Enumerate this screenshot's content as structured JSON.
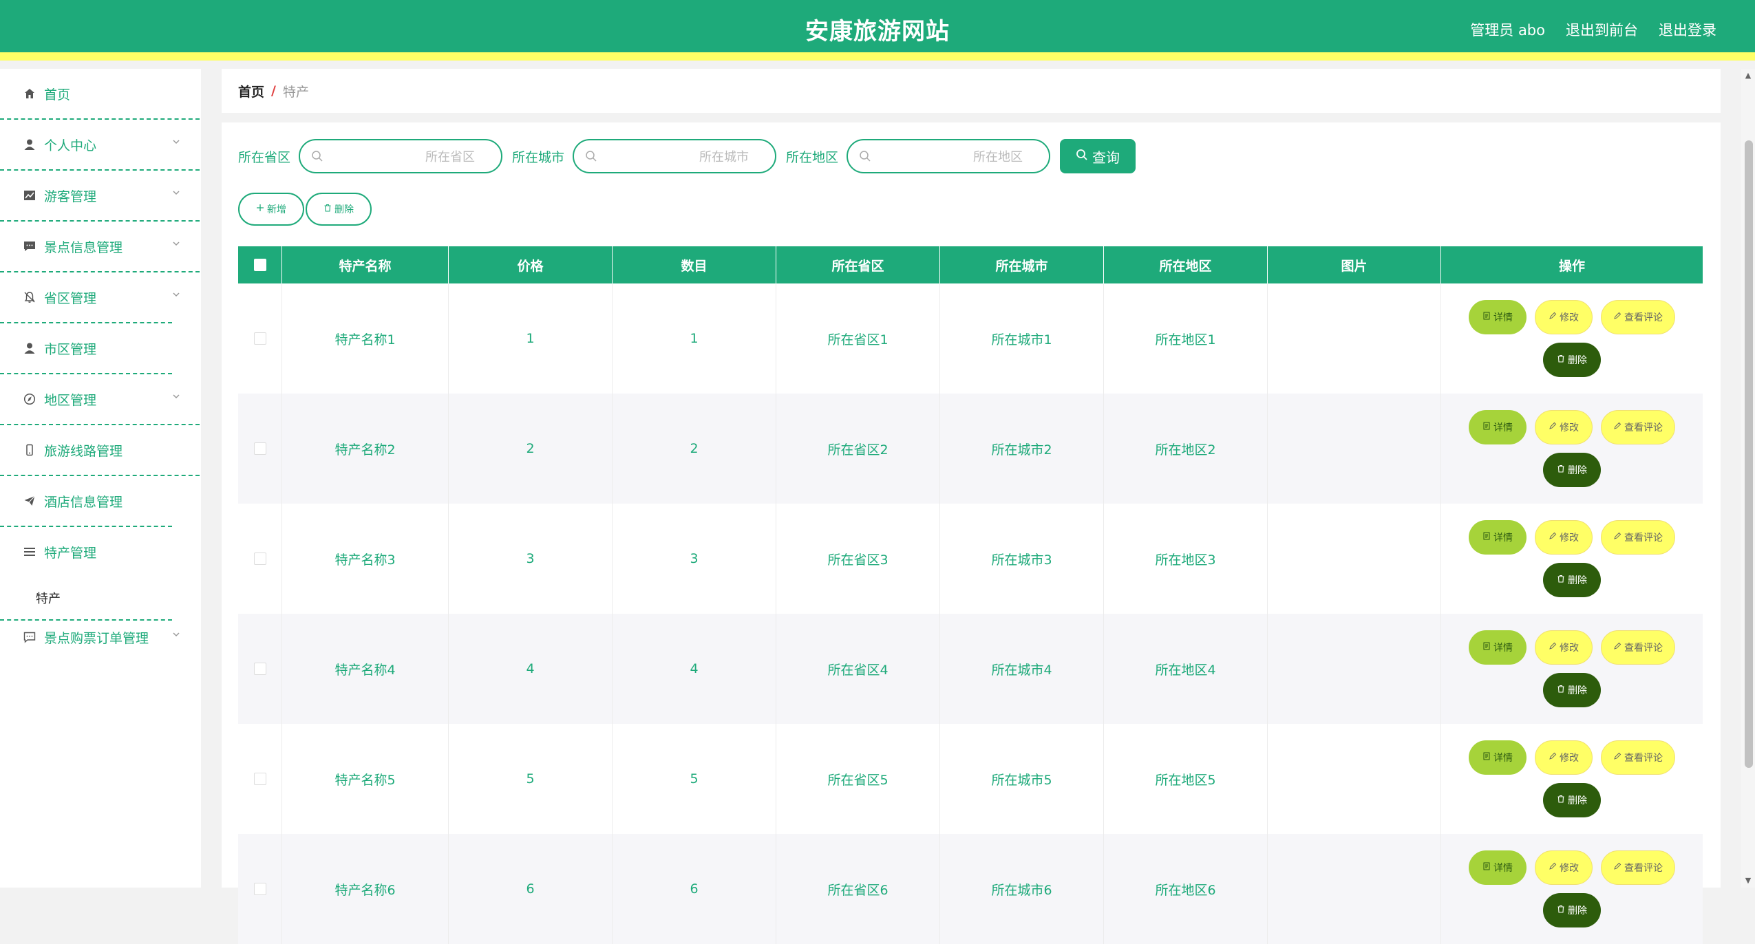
{
  "header": {
    "title": "安康旅游网站",
    "nav": [
      "管理员 abo",
      "退出到前台",
      "退出登录"
    ]
  },
  "sidebar": {
    "items": [
      {
        "label": "首页",
        "icon": "home-icon",
        "chevron": false
      },
      {
        "label": "个人中心",
        "icon": "user-icon",
        "chevron": true
      },
      {
        "label": "游客管理",
        "icon": "chart-icon",
        "chevron": true
      },
      {
        "label": "景点信息管理",
        "icon": "message-icon",
        "chevron": true
      },
      {
        "label": "省区管理",
        "icon": "bell-icon",
        "chevron": true
      },
      {
        "label": "市区管理",
        "icon": "user-icon",
        "chevron": false
      },
      {
        "label": "地区管理",
        "icon": "compass-icon",
        "chevron": true
      },
      {
        "label": "旅游线路管理",
        "icon": "phone-icon",
        "chevron": false
      },
      {
        "label": "酒店信息管理",
        "icon": "send-icon",
        "chevron": false
      },
      {
        "label": "特产管理",
        "icon": "list-icon",
        "chevron": false
      }
    ],
    "sub_item": "特产",
    "last_item": {
      "label": "景点购票订单管理",
      "icon": "chat-icon",
      "chevron": true
    }
  },
  "breadcrumb": {
    "home": "首页",
    "separator": "/",
    "current": "特产"
  },
  "search": {
    "fields": [
      {
        "label": "所在省区",
        "placeholder": "所在省区"
      },
      {
        "label": "所在城市",
        "placeholder": "所在城市"
      },
      {
        "label": "所在地区",
        "placeholder": "所在地区"
      }
    ],
    "button": "查询"
  },
  "actions": {
    "add": "新增",
    "delete": "删除"
  },
  "table": {
    "columns": [
      "特产名称",
      "价格",
      "数目",
      "所在省区",
      "所在城市",
      "所在地区",
      "图片",
      "操作"
    ],
    "rows": [
      {
        "name": "特产名称1",
        "price": "1",
        "count": "1",
        "province": "所在省区1",
        "city": "所在城市1",
        "area": "所在地区1"
      },
      {
        "name": "特产名称2",
        "price": "2",
        "count": "2",
        "province": "所在省区2",
        "city": "所在城市2",
        "area": "所在地区2"
      },
      {
        "name": "特产名称3",
        "price": "3",
        "count": "3",
        "province": "所在省区3",
        "city": "所在城市3",
        "area": "所在地区3"
      },
      {
        "name": "特产名称4",
        "price": "4",
        "count": "4",
        "province": "所在省区4",
        "city": "所在城市4",
        "area": "所在地区4"
      },
      {
        "name": "特产名称5",
        "price": "5",
        "count": "5",
        "province": "所在省区5",
        "city": "所在城市5",
        "area": "所在地区5"
      },
      {
        "name": "特产名称6",
        "price": "6",
        "count": "6",
        "province": "所在省区6",
        "city": "所在城市6",
        "area": "所在地区6"
      }
    ],
    "row_actions": {
      "detail": "详情",
      "edit": "修改",
      "review": "查看评论",
      "delete": "删除"
    }
  },
  "colors": {
    "primary": "#1eaa7a",
    "accent": "#ffff66",
    "detail": "#a6d33a",
    "danger": "#2d5c0c"
  }
}
